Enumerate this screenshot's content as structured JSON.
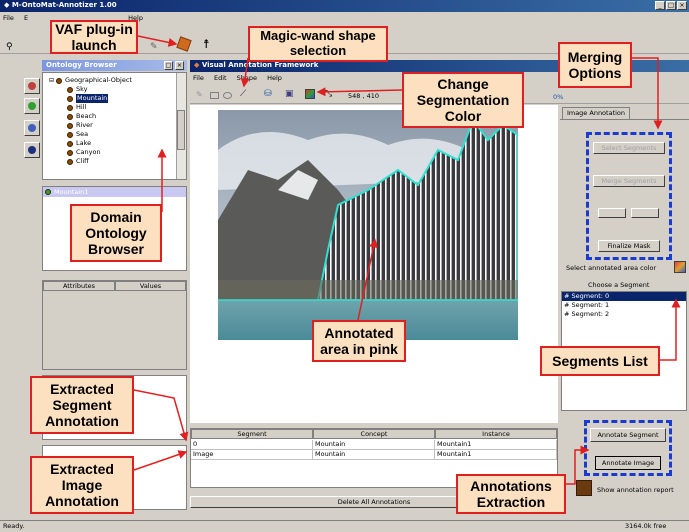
{
  "main_window": {
    "title": "M-OntoMat-Annotizer 1.00",
    "menu": [
      "File",
      "E",
      "Help"
    ]
  },
  "ontology_browser": {
    "title": "Ontology Browser",
    "root": "Geographical-Object",
    "items": [
      "Sky",
      "Mountain",
      "Hill",
      "Beach",
      "River",
      "Sea",
      "Lake",
      "Canyon",
      "Cliff"
    ],
    "selected_instance": "Mountain1",
    "attr_headers": [
      "Attributes",
      "Values"
    ]
  },
  "vaf_window": {
    "title": "Visual Annotation Framework",
    "menu": [
      "File",
      "Edit",
      "Shape",
      "Help"
    ],
    "coords": "548 , 410",
    "progress_label": "0%",
    "annotation_headers": [
      "Segment",
      "Concept",
      "Instance"
    ],
    "annotation_rows": [
      [
        "0",
        "Mountain",
        "Mountain1"
      ],
      [
        "Image",
        "Mountain",
        "Mountain1"
      ]
    ],
    "delete_all": "Delete All Annotations"
  },
  "right_panel": {
    "tab": "Image Annotation",
    "select_segments": "Select Segments",
    "merge_segments": "Merge Segments",
    "finalize_mask": "Finalize Mask",
    "select_color_label": "Select annotated area color",
    "choose_segment": "Choose a Segment",
    "segments": [
      "# Segment: 0",
      "# Segment: 1",
      "# Segment: 2"
    ],
    "annotate_segment": "Annotate Segment",
    "annotate_image": "Annotate Image",
    "show_report": "Show annotation report"
  },
  "status": {
    "left": "Ready.",
    "right": "3164.0k free"
  },
  "callouts": {
    "vaf_plugin": "VAF plug-in launch",
    "magic_wand": "Magic-wand shape selection",
    "merging": "Merging Options",
    "change_color": "Change Segmentation Color",
    "domain_ontology": "Domain Ontology Browser",
    "annotated_area": "Annotated area in pink",
    "segments_list": "Segments List",
    "extracted_segment": "Extracted Segment Annotation",
    "extracted_image": "Extracted Image Annotation",
    "annotations_extraction": "Annotations Extraction"
  },
  "colors": {
    "callout_border": "#e02020",
    "callout_fill": "#fde0c0",
    "dashed_box": "#1a3ad0",
    "titlebar": "#0a246a",
    "selection": "#0a246a"
  }
}
